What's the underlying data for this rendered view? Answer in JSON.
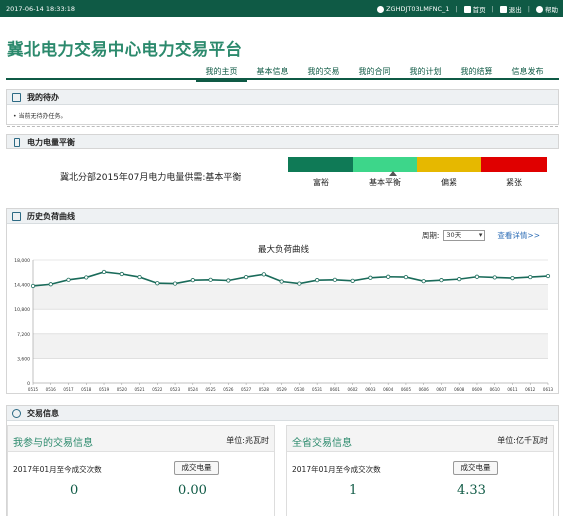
{
  "topbar": {
    "time": "2017-06-14 18:33:18",
    "user": "ZGHDJT03LMFNC_1",
    "home": "首页",
    "logout": "退出",
    "help": "帮助"
  },
  "header": {
    "title": "冀北电力交易中心电力交易平台",
    "nav": [
      "我的主页",
      "基本信息",
      "我的交易",
      "我的合同",
      "我的计划",
      "我的结算",
      "信息发布"
    ],
    "active_index": 0
  },
  "todo": {
    "title": "我的待办",
    "text": "当前无待办任务。"
  },
  "balance": {
    "title": "电力电量平衡",
    "text": "冀北分部2015年07月电力电量供需:基本平衡",
    "levels": [
      {
        "label": "富裕",
        "color": "#0f7a56"
      },
      {
        "label": "基本平衡",
        "color": "#3dd68a"
      },
      {
        "label": "偏紧",
        "color": "#e6b800"
      },
      {
        "label": "紧张",
        "color": "#e00000"
      }
    ]
  },
  "history": {
    "title": "历史负荷曲线",
    "period_label": "周期:",
    "period_value": "30天",
    "details_link": "查看详情>>"
  },
  "chart_data": {
    "type": "line",
    "title": "最大负荷曲线",
    "x": [
      "0515",
      "0516",
      "0517",
      "0518",
      "0519",
      "0520",
      "0521",
      "0522",
      "0523",
      "0524",
      "0525",
      "0526",
      "0527",
      "0528",
      "0529",
      "0530",
      "0531",
      "0601",
      "0602",
      "0603",
      "0604",
      "0605",
      "0606",
      "0607",
      "0608",
      "0609",
      "0610",
      "0611",
      "0612",
      "0613"
    ],
    "series": [
      {
        "values": [
          14200,
          14450,
          15100,
          15450,
          16250,
          15950,
          15500,
          14600,
          14550,
          15050,
          15100,
          15000,
          15500,
          15900,
          14850,
          14550,
          15050,
          15100,
          14950,
          15400,
          15550,
          15500,
          14900,
          15050,
          15200,
          15550,
          15450,
          15350,
          15500,
          15650
        ],
        "color": "#1a6b5a"
      }
    ],
    "ylim": [
      0,
      18000
    ],
    "yticks": [
      "0",
      "3,600",
      "7,200",
      "10,800",
      "14,400",
      "18,000"
    ],
    "grid": true
  },
  "trade": {
    "title": "交易信息",
    "mine": {
      "name": "我参与的交易信息",
      "unit": "单位:兆瓦时",
      "period": "2017年01月至今成交次数",
      "btn": "成交电量",
      "count": "0",
      "energy": "0.00"
    },
    "all": {
      "name": "全省交易信息",
      "unit": "单位:亿千瓦时",
      "period": "2017年01月至今成交次数",
      "btn": "成交电量",
      "count": "1",
      "energy": "4.33"
    }
  }
}
